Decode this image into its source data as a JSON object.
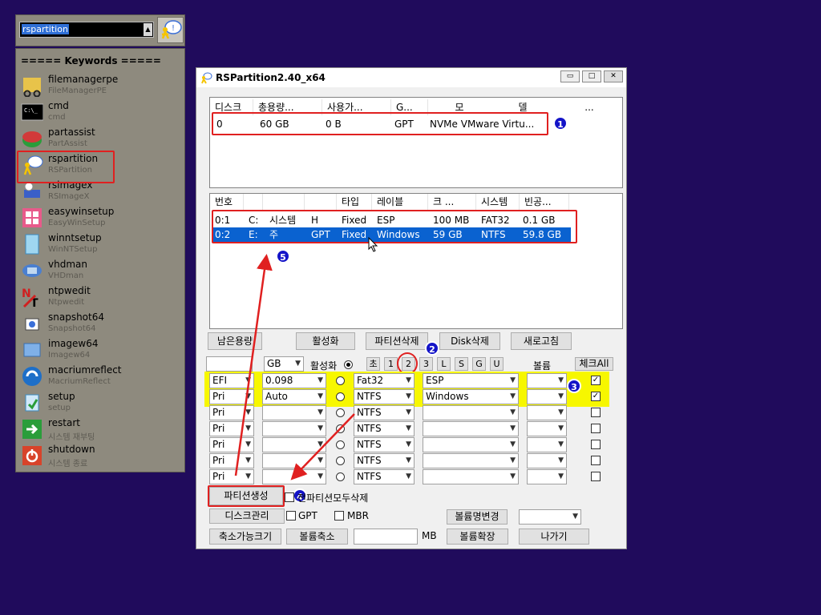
{
  "launcher": {
    "search_value": "rspartition",
    "keywords_title": "===== Keywords =====",
    "items": [
      {
        "name": "filemanagerpe",
        "sub": "FileManagerPE",
        "icon": "folder-glasses-icon"
      },
      {
        "name": "cmd",
        "sub": "cmd",
        "icon": "command-prompt-icon"
      },
      {
        "name": "partassist",
        "sub": "PartAssist",
        "icon": "partassist-icon"
      },
      {
        "name": "rspartition",
        "sub": "RSPartition",
        "icon": "rspartition-icon"
      },
      {
        "name": "rsimagex",
        "sub": "RSImageX",
        "icon": "rsimagex-icon"
      },
      {
        "name": "easywinsetup",
        "sub": "EasyWinSetup",
        "icon": "windows-logo-icon"
      },
      {
        "name": "winntsetup",
        "sub": "WinNTSetup",
        "icon": "winntsetup-icon"
      },
      {
        "name": "vhdman",
        "sub": "VHDman",
        "icon": "vhdman-icon"
      },
      {
        "name": "ntpwedit",
        "sub": "Ntpwedit",
        "icon": "ntpwedit-key-icon"
      },
      {
        "name": "snapshot64",
        "sub": "Snapshot64",
        "icon": "snapshot-icon"
      },
      {
        "name": "imagew64",
        "sub": "Imagew64",
        "icon": "imagew-icon"
      },
      {
        "name": "macriumreflect",
        "sub": "MacriumReflect",
        "icon": "macrium-icon"
      },
      {
        "name": "setup",
        "sub": "setup",
        "icon": "setup-icon"
      },
      {
        "name": "restart",
        "sub": "시스템 재부팅",
        "icon": "restart-arrow-icon"
      },
      {
        "name": "shutdown",
        "sub": "시스템 종료",
        "icon": "shutdown-icon"
      }
    ]
  },
  "window": {
    "title": "RSPartition2.40_x64",
    "disk_headers": [
      "디스크",
      "총용량...",
      "사용가...",
      "G...",
      "모",
      "델",
      "..."
    ],
    "disk_row": [
      "0",
      "60 GB",
      "0 B",
      "GPT",
      "NVMe VMware Virtu..."
    ],
    "part_headers": [
      "번호",
      "",
      "",
      "",
      "타입",
      "레이블",
      "크 ...",
      "시스템",
      "빈공..."
    ],
    "part_rows": [
      [
        "0:1",
        "C:",
        "시스템",
        "H",
        "Fixed",
        "ESP",
        "100 MB",
        "FAT32",
        "0.1 GB"
      ],
      [
        "0:2",
        "E:",
        "주",
        "GPT",
        "Fixed",
        "Windows",
        "59 GB",
        "NTFS",
        "59.8 GB"
      ]
    ],
    "buttons": {
      "free": "남은용량",
      "activate": "활성화",
      "delete_part": "파티션삭제",
      "delete_disk": "Disk삭제",
      "refresh": "새로고침",
      "create": "파티션생성",
      "disk_mgmt": "디스크관리",
      "shrink_size": "축소가능크기",
      "shrink": "볼륨축소",
      "extend": "볼륨확장",
      "exit": "나가기",
      "rename": "볼륨명변경",
      "check_all": "체크All"
    },
    "unit": "GB",
    "active_label": "활성화",
    "tabs": [
      "초",
      "1",
      "2",
      "3",
      "L",
      "S",
      "G",
      "U"
    ],
    "volume_label": "볼륨",
    "rows": [
      {
        "type": "EFI",
        "size": "0.098",
        "fs": "Fat32",
        "label": "ESP",
        "checked": true
      },
      {
        "type": "Pri",
        "size": "Auto",
        "fs": "NTFS",
        "label": "Windows",
        "checked": true
      },
      {
        "type": "Pri",
        "size": "",
        "fs": "NTFS",
        "label": "",
        "checked": false
      },
      {
        "type": "Pri",
        "size": "",
        "fs": "NTFS",
        "label": "",
        "checked": false
      },
      {
        "type": "Pri",
        "size": "",
        "fs": "NTFS",
        "label": "",
        "checked": false
      },
      {
        "type": "Pri",
        "size": "",
        "fs": "NTFS",
        "label": "",
        "checked": false
      },
      {
        "type": "Pri",
        "size": "",
        "fs": "NTFS",
        "label": "",
        "checked": false
      }
    ],
    "delete_all_label": "전파티션모두삭제",
    "gpt_label": "GPT",
    "mbr_label": "MBR",
    "mb_label": "MB"
  },
  "annotations": [
    "1",
    "2",
    "3",
    "4",
    "5"
  ],
  "colors": {
    "desktop": "#200b5c",
    "highlight": "#f7f700",
    "marker": "#e02020",
    "badge": "#1414c8",
    "selection": "#0a62d0"
  }
}
